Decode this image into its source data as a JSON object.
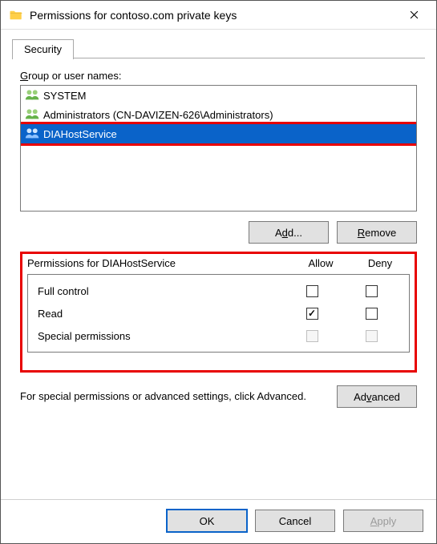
{
  "window": {
    "title": "Permissions for contoso.com private keys"
  },
  "tabs": {
    "security": "Security"
  },
  "labels": {
    "group_or_user_prefix": "G",
    "group_or_user_rest": "roup or user names:",
    "add_prefix": "A",
    "add_u": "d",
    "add_suffix": "d...",
    "remove_u": "R",
    "remove_rest": "emove",
    "perm_for_prefix": "Permissions for ",
    "perm_for_name": "DIAHostService",
    "allow": "Allow",
    "deny": "Deny",
    "adv_text": "For special permissions or advanced settings, click Advanced.",
    "advanced_prefix": "Ad",
    "advanced_u": "v",
    "advanced_rest": "anced",
    "ok": "OK",
    "cancel": "Cancel",
    "apply_u": "A",
    "apply_rest": "pply"
  },
  "principals": [
    {
      "name": "SYSTEM",
      "selected": false
    },
    {
      "name": "Administrators (CN-DAVIZEN-626\\Administrators)",
      "selected": false
    },
    {
      "name": "DIAHostService",
      "selected": true
    }
  ],
  "permissions": [
    {
      "name": "Full control",
      "allow": false,
      "deny": false,
      "disabled": false
    },
    {
      "name": "Read",
      "allow": true,
      "deny": false,
      "disabled": false
    },
    {
      "name": "Special permissions",
      "allow": false,
      "deny": false,
      "disabled": true
    }
  ]
}
